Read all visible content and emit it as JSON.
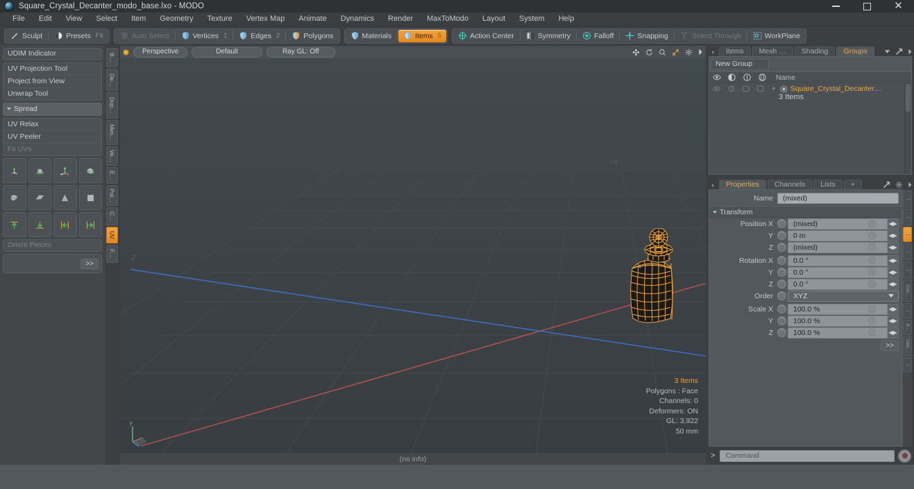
{
  "window": {
    "title": "Square_Crystal_Decanter_modo_base.lxo - MODO",
    "minimize": "—",
    "maximize": "□",
    "close": "✕"
  },
  "menubar": {
    "items": [
      "File",
      "Edit",
      "View",
      "Select",
      "Item",
      "Geometry",
      "Texture",
      "Vertex Map",
      "Animate",
      "Dynamics",
      "Render",
      "MaxToModo",
      "Layout",
      "System",
      "Help"
    ]
  },
  "toolbar": {
    "group1": [
      {
        "label": "Sculpt",
        "icon": "brush-icon",
        "dim": false,
        "num": ""
      },
      {
        "label": "Presets",
        "icon": "sphere-icon",
        "dim": false,
        "num": "F6"
      }
    ],
    "group2": [
      {
        "label": "Auto Select",
        "icon": "shield-icon",
        "dim": true,
        "num": ""
      },
      {
        "label": "Vertices",
        "icon": "vertices-icon",
        "dim": false,
        "num": "1"
      },
      {
        "label": "Edges",
        "icon": "edges-icon",
        "dim": false,
        "num": "2"
      },
      {
        "label": "Polygons",
        "icon": "polygons-icon",
        "dim": false,
        "num": ""
      }
    ],
    "group3": [
      {
        "label": "Materials",
        "icon": "materials-icon",
        "dim": false,
        "num": "",
        "active": false
      },
      {
        "label": "Items",
        "icon": "items-icon",
        "dim": false,
        "num": "5",
        "active": true
      }
    ],
    "group4": [
      {
        "label": "Action Center",
        "icon": "action-center-icon",
        "dim": false,
        "num": ""
      },
      {
        "label": "Symmetry",
        "icon": "symmetry-icon",
        "dim": false,
        "num": ""
      },
      {
        "label": "Falloff",
        "icon": "falloff-icon",
        "dim": false,
        "num": ""
      },
      {
        "label": "Snapping",
        "icon": "snapping-icon",
        "dim": false,
        "num": ""
      },
      {
        "label": "Select Through",
        "icon": "select-through-icon",
        "dim": true,
        "num": ""
      },
      {
        "label": "WorkPlane",
        "icon": "workplane-icon",
        "dim": false,
        "num": ""
      }
    ]
  },
  "left_panel": {
    "udim": "UDIM Indicator",
    "uv_tools": [
      "UV Projection Tool",
      "Project from View",
      "Unwrap Tool"
    ],
    "spread_header": "Spread",
    "relax_tools": [
      "UV Relax",
      "UV Peeler",
      "Fit UVs"
    ],
    "orient": "Orient Pieces",
    "more_label": ">>",
    "vtabs": [
      {
        "label": "B…",
        "on": false
      },
      {
        "label": "De…",
        "on": false
      },
      {
        "label": "Dup…",
        "on": false
      },
      {
        "label": "Mes…",
        "on": false
      },
      {
        "label": "Ve…",
        "on": false
      },
      {
        "label": "E…",
        "on": false
      },
      {
        "label": "Pol…",
        "on": false
      },
      {
        "label": "C…",
        "on": false
      },
      {
        "label": "UV",
        "on": true
      },
      {
        "label": "F…",
        "on": false
      }
    ]
  },
  "viewport": {
    "view_mode": "Perspective",
    "shading": "Default",
    "raygl": "Ray GL: Off",
    "axis_x": "+X",
    "axis_z": "-Z",
    "gizmo_y": "Y",
    "info": {
      "items": "3 Items",
      "polygons": "Polygons : Face",
      "channels": "Channels: 0",
      "deformers": "Deformers: ON",
      "gl": "GL: 3,922",
      "scale": "50 mm"
    },
    "status": "(no info)"
  },
  "right_panel": {
    "tabs": [
      {
        "label": "Items",
        "on": false
      },
      {
        "label": "Mesh …",
        "on": false
      },
      {
        "label": "Shading",
        "on": false
      },
      {
        "label": "Groups",
        "on": true
      }
    ],
    "new_group": "New Group",
    "tree_header": {
      "name": "Name"
    },
    "tree_rows": [
      {
        "name": "Square_Crystal_Decanter…",
        "subtitle": "3 Items"
      }
    ],
    "prop_tabs": [
      {
        "label": "Properties",
        "on": true
      },
      {
        "label": "Channels",
        "on": false
      },
      {
        "label": "Lists",
        "on": false
      },
      {
        "label": "+",
        "on": false
      }
    ],
    "name_label": "Name",
    "name_value": "(mixed)",
    "transform_header": "Transform",
    "transform": [
      {
        "label": "Position X",
        "value": "(mixed)",
        "type": "num"
      },
      {
        "label": "Y",
        "value": "0 m",
        "type": "num"
      },
      {
        "label": "Z",
        "value": "(mixed)",
        "type": "num"
      },
      {
        "label": "Rotation X",
        "value": "0.0 °",
        "type": "num"
      },
      {
        "label": "Y",
        "value": "0.0 °",
        "type": "num"
      },
      {
        "label": "Z",
        "value": "0.0 °",
        "type": "num"
      },
      {
        "label": "Order",
        "value": "XYZ",
        "type": "select"
      },
      {
        "label": "Scale X",
        "value": "100.0 %",
        "type": "num"
      },
      {
        "label": "Y",
        "value": "100.0 %",
        "type": "num"
      },
      {
        "label": "Z",
        "value": "100.0 %",
        "type": "num"
      }
    ],
    "more_label": ">>",
    "side_tabs": [
      {
        "label": "⋮",
        "on": false
      },
      {
        "label": "⋮",
        "on": false
      },
      {
        "label": "⋮",
        "on": true
      },
      {
        "label": "⋮",
        "on": false
      },
      {
        "label": "⋮",
        "on": false
      },
      {
        "label": "Gro…",
        "on": false
      },
      {
        "label": "⋮",
        "on": false
      },
      {
        "label": "A…",
        "on": false
      },
      {
        "label": "Use…",
        "on": false
      },
      {
        "label": "⋮",
        "on": false
      }
    ]
  },
  "command_bar": {
    "prompt": ">",
    "placeholder": "Command",
    "record_icon": "record-icon"
  },
  "colors": {
    "accent": "#e8a33c",
    "wireframe": "#f0a43c",
    "panel": "#53585c",
    "viewport_bg": "#3c4246"
  }
}
